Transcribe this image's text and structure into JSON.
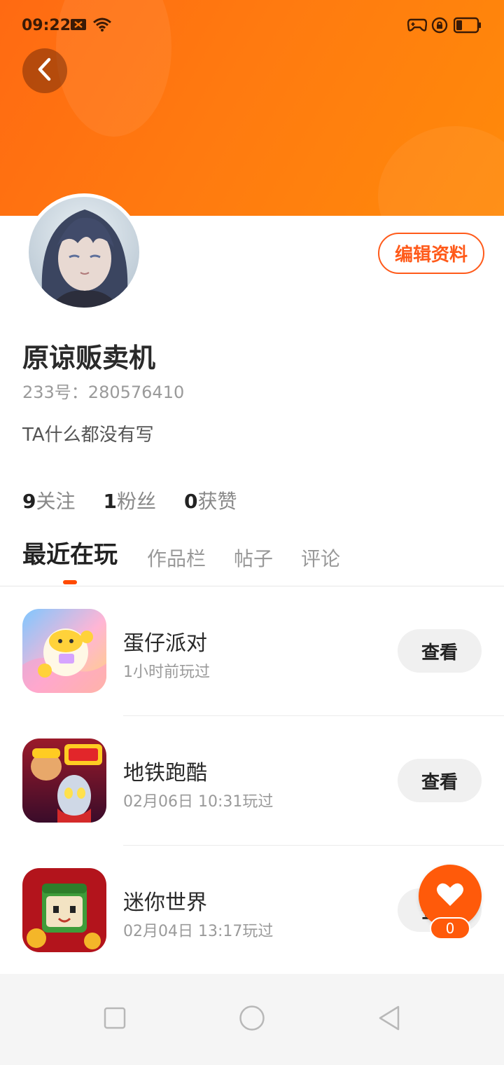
{
  "status_bar": {
    "time": "09:22",
    "icons": [
      "notification-x-icon",
      "wifi-icon",
      "game-controller-icon",
      "rotation-lock-icon",
      "battery-icon"
    ]
  },
  "header": {
    "back_icon": "chevron-left-icon",
    "accent_color": "#ff6a12"
  },
  "profile": {
    "edit_label": "编辑资料",
    "username": "原谅贩卖机",
    "user_id": "233号：280576410",
    "bio": "TA什么都没有写",
    "stats": [
      {
        "count": "9",
        "label": "关注"
      },
      {
        "count": "1",
        "label": "粉丝"
      },
      {
        "count": "0",
        "label": "获赞"
      }
    ]
  },
  "tabs": [
    {
      "label": "最近在玩",
      "active": true
    },
    {
      "label": "作品栏",
      "active": false
    },
    {
      "label": "帖子",
      "active": false
    },
    {
      "label": "评论",
      "active": false
    }
  ],
  "games": [
    {
      "name": "蛋仔派对",
      "played": "1小时前玩过",
      "button": "查看"
    },
    {
      "name": "地铁跑酷",
      "played": "02月06日 10:31玩过",
      "button": "查看"
    },
    {
      "name": "迷你世界",
      "played": "02月04日 13:17玩过",
      "button": "查看"
    }
  ],
  "like": {
    "icon": "heart-icon",
    "count": "0"
  },
  "nav": [
    "recent-apps-icon",
    "home-icon",
    "back-icon"
  ]
}
